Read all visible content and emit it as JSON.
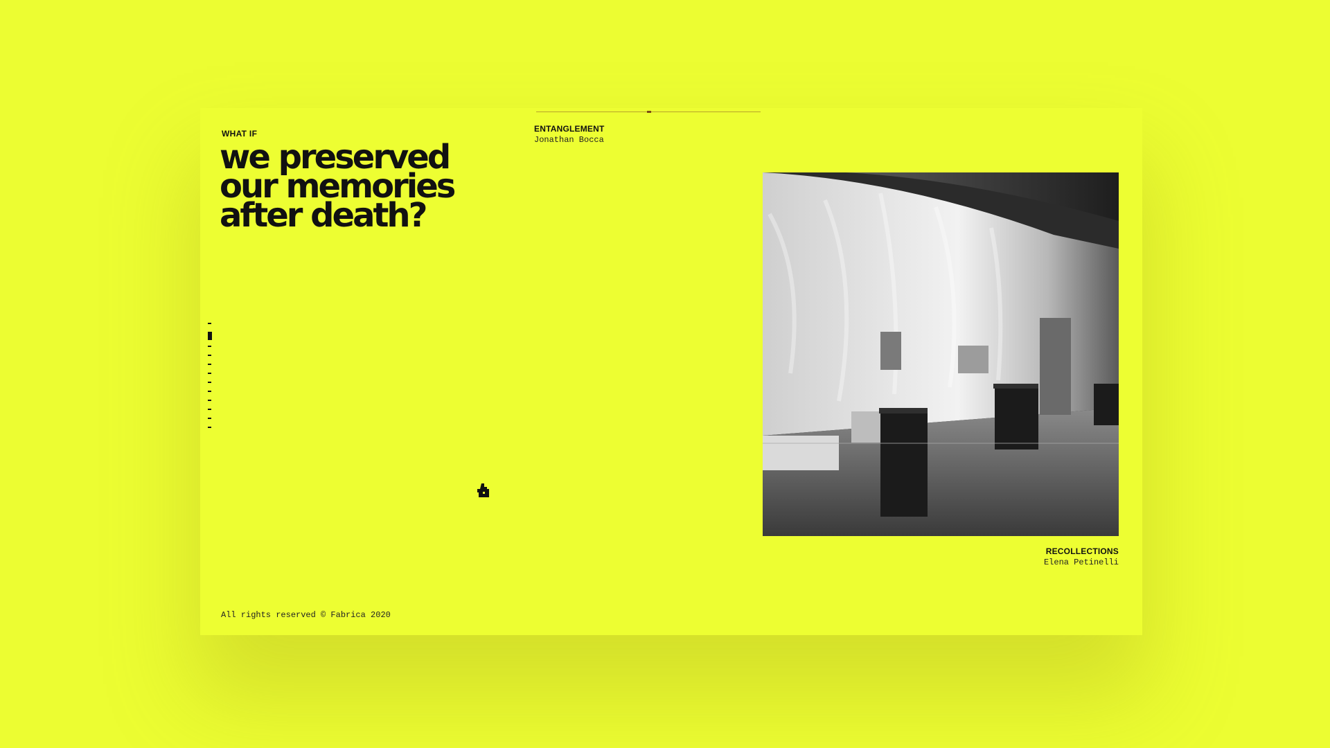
{
  "hero": {
    "eyebrow": "WHAT IF",
    "headline_lines": [
      "we preserved",
      "our memories",
      "after death?"
    ]
  },
  "projects": {
    "left": {
      "title": "ENTANGLEMENT",
      "author": "Jonathan Bocca"
    },
    "right": {
      "title": "RECOLLECTIONS",
      "author": "Elena Petinelli"
    }
  },
  "photo": {
    "alt": "exhibition-room-photo"
  },
  "footer": {
    "copyright": "All rights reserved © Fabrica 2020"
  },
  "scroll_index": {
    "count": 12,
    "active": 1
  },
  "colors": {
    "background": "#edfe32",
    "ink": "#111111"
  }
}
